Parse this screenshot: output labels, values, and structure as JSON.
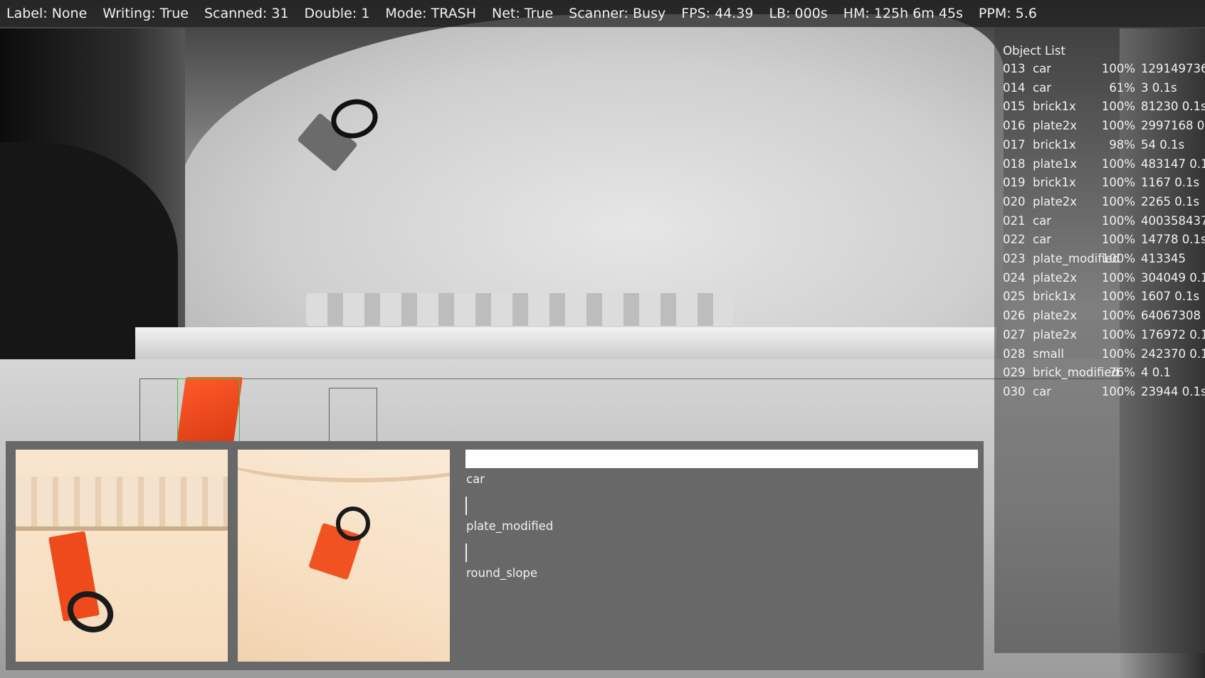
{
  "status_bar": {
    "label": "Label: None",
    "writing": "Writing: True",
    "scanned": "Scanned: 31",
    "double": "Double: 1",
    "mode": "Mode: TRASH",
    "net": "Net: True",
    "scanner": "Scanner: Busy",
    "fps": "FPS: 44.39",
    "lb": "LB: 000s",
    "hm": "HM: 125h 6m 45s",
    "ppm": "PPM: 5.6"
  },
  "object_list": {
    "title": "Object List",
    "rows": [
      {
        "id": "013",
        "name": "car",
        "pct": "100%",
        "rest": "129149736"
      },
      {
        "id": "014",
        "name": "car",
        "pct": "61%",
        "rest": "3 0.1s"
      },
      {
        "id": "015",
        "name": "brick1x",
        "pct": "100%",
        "rest": "81230 0.1s"
      },
      {
        "id": "016",
        "name": "plate2x",
        "pct": "100%",
        "rest": "2997168 0"
      },
      {
        "id": "017",
        "name": "brick1x",
        "pct": "98%",
        "rest": "54 0.1s"
      },
      {
        "id": "018",
        "name": "plate1x",
        "pct": "100%",
        "rest": "483147 0.1"
      },
      {
        "id": "019",
        "name": "brick1x",
        "pct": "100%",
        "rest": "1167 0.1s"
      },
      {
        "id": "020",
        "name": "plate2x",
        "pct": "100%",
        "rest": "2265 0.1s"
      },
      {
        "id": "021",
        "name": "car",
        "pct": "100%",
        "rest": "400358437"
      },
      {
        "id": "022",
        "name": "car",
        "pct": "100%",
        "rest": "14778 0.1s"
      },
      {
        "id": "023",
        "name": "plate_modified",
        "pct": "100%",
        "rest": "413345"
      },
      {
        "id": "024",
        "name": "plate2x",
        "pct": "100%",
        "rest": "304049 0.1"
      },
      {
        "id": "025",
        "name": "brick1x",
        "pct": "100%",
        "rest": "1607 0.1s"
      },
      {
        "id": "026",
        "name": "plate2x",
        "pct": "100%",
        "rest": "64067308"
      },
      {
        "id": "027",
        "name": "plate2x",
        "pct": "100%",
        "rest": "176972 0.1"
      },
      {
        "id": "028",
        "name": "small",
        "pct": "100%",
        "rest": "242370 0.1"
      },
      {
        "id": "029",
        "name": "brick_modified",
        "pct": "76%",
        "rest": "4 0.1"
      },
      {
        "id": "030",
        "name": "car",
        "pct": "100%",
        "rest": "23944 0.1s"
      }
    ]
  },
  "classification": {
    "items": [
      {
        "label": "car",
        "value": 1.0
      },
      {
        "label": "plate_modified",
        "value": 0.0
      },
      {
        "label": "round_slope",
        "value": 0.0
      }
    ]
  },
  "colors": {
    "bar": "#ffffff",
    "detection_box": "#37c437",
    "panel": "#686868"
  }
}
